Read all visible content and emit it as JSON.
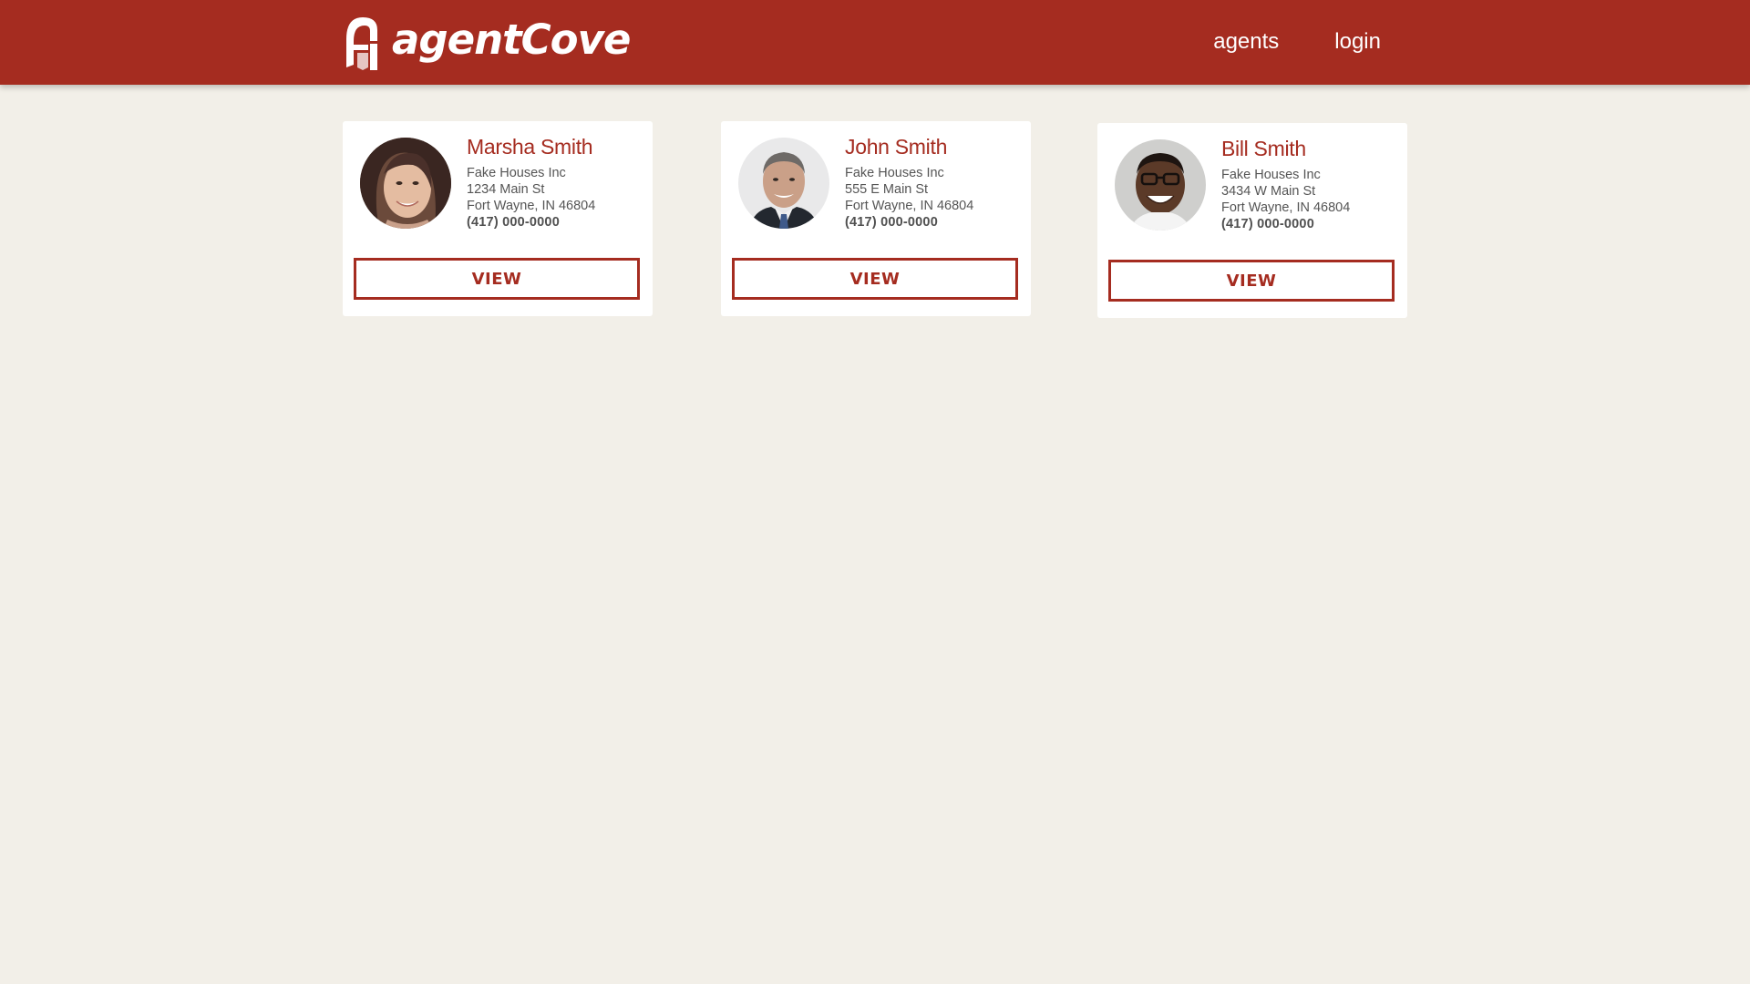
{
  "header": {
    "brand_name": "agentCove",
    "nav": [
      {
        "label": "agents"
      },
      {
        "label": "login"
      }
    ]
  },
  "agents": [
    {
      "name": "Marsha Smith",
      "company": "Fake Houses Inc",
      "street": "1234 Main St",
      "city": "Fort Wayne, IN 46804",
      "phone": "(417) 000-0000",
      "button_label": "VIEW"
    },
    {
      "name": "John Smith",
      "company": "Fake Houses Inc",
      "street": "555 E Main St",
      "city": "Fort Wayne, IN 46804",
      "phone": "(417) 000-0000",
      "button_label": "VIEW"
    },
    {
      "name": "Bill Smith",
      "company": "Fake Houses Inc",
      "street": "3434 W Main St",
      "city": "Fort Wayne, IN 46804",
      "phone": "(417) 000-0000",
      "button_label": "VIEW"
    }
  ],
  "colors": {
    "brand": "#a52c20",
    "page_background": "#f2efe8",
    "card_background": "#ffffff",
    "body_text": "#555555"
  },
  "icons": {
    "logo": "agentcove-logo-icon",
    "avatar": "avatar"
  }
}
